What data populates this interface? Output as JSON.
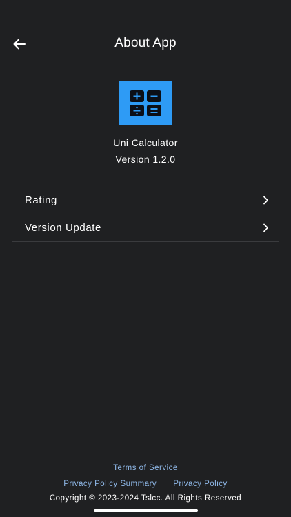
{
  "header": {
    "title": "About App",
    "back_icon": "arrow-left-icon"
  },
  "app": {
    "name": "Uni Calculator",
    "version": "Version 1.2.0",
    "icon": "calculator-icon",
    "icon_color": "#2e9bf5"
  },
  "menu": {
    "items": [
      {
        "label": "Rating",
        "icon": "chevron-right-icon"
      },
      {
        "label": "Version Update",
        "icon": "chevron-right-icon"
      }
    ]
  },
  "footer": {
    "terms": "Terms of Service",
    "privacy_summary": "Privacy Policy Summary",
    "privacy_policy": "Privacy Policy",
    "copyright": "Copyright © 2023-2024 Tslcc. All Rights Reserved",
    "link_color": "#8fb8e8"
  },
  "colors": {
    "background": "#1f2022",
    "divider": "#3a3b3e"
  }
}
